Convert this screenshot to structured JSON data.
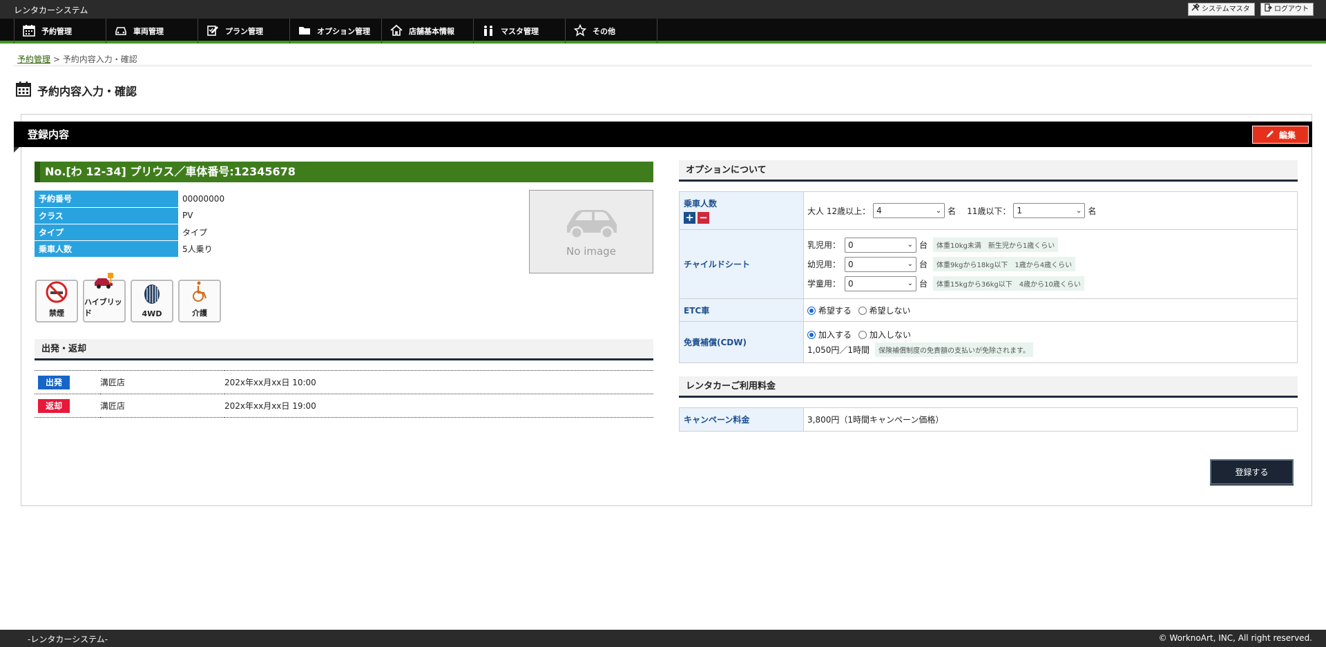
{
  "app": {
    "title": "レンタカーシステム"
  },
  "top_buttons": {
    "system_master": "システムマスタ",
    "logout": "ログアウト"
  },
  "nav": [
    {
      "label": "予約管理",
      "icon": "calendar-icon"
    },
    {
      "label": "車両管理",
      "icon": "car-icon"
    },
    {
      "label": "プラン管理",
      "icon": "edit-document-icon"
    },
    {
      "label": "オプション管理",
      "icon": "folder-icon"
    },
    {
      "label": "店舗基本情報",
      "icon": "home-icon"
    },
    {
      "label": "マスタ管理",
      "icon": "people-icon"
    },
    {
      "label": "その他",
      "icon": "star-icon"
    }
  ],
  "breadcrumb": {
    "parent": "予約管理",
    "separator": " > ",
    "current": "予約内容入力・確認"
  },
  "page_title": "予約内容入力・確認",
  "panel": {
    "title": "登録内容",
    "edit_label": "編集"
  },
  "car": {
    "title": "No.[わ 12-34] プリウス／車体番号:12345678",
    "info": [
      {
        "label": "予約番号",
        "value": "00000000"
      },
      {
        "label": "クラス",
        "value": "PV"
      },
      {
        "label": "タイプ",
        "value": "タイプ"
      },
      {
        "label": "乗車人数",
        "value": "5人乗り"
      }
    ],
    "no_image_text": "No image",
    "features": [
      {
        "label": "禁煙",
        "icon": "no-smoking-icon"
      },
      {
        "label": "ハイブリッド",
        "icon": "hybrid-car-icon"
      },
      {
        "label": "4WD",
        "icon": "tire-icon"
      },
      {
        "label": "介護",
        "icon": "wheelchair-icon"
      }
    ]
  },
  "departure": {
    "heading": "出発・返却",
    "rows": [
      {
        "badge": "出発",
        "store": "溝匠店",
        "datetime": "202x年xx月xx日 10:00",
        "color": "#1665c9"
      },
      {
        "badge": "返却",
        "store": "溝匠店",
        "datetime": "202x年xx月xx日 19:00",
        "color": "#e8183a"
      }
    ]
  },
  "options": {
    "heading": "オプションについて",
    "passengers": {
      "label": "乗車人数",
      "adult_label": "大人 12歳以上：",
      "adult_value": "4",
      "child_label": "11歳以下：",
      "child_value": "1",
      "unit": "名"
    },
    "child_seat": {
      "label": "チャイルドシート",
      "unit": "台",
      "rows": [
        {
          "label": "乳児用：",
          "value": "0",
          "note": "体重10kg未満　新生児から1歳くらい"
        },
        {
          "label": "幼児用：",
          "value": "0",
          "note": "体重9kgから18kg以下　1歳から4歳くらい"
        },
        {
          "label": "学童用：",
          "value": "0",
          "note": "体重15kgから36kg以下　4歳から10歳くらい"
        }
      ]
    },
    "etc": {
      "label": "ETC車",
      "opt_yes": "希望する",
      "opt_no": "希望しない",
      "selected": "希望する"
    },
    "cdw": {
      "label": "免責補償(CDW)",
      "opt_yes": "加入する",
      "opt_no": "加入しない",
      "selected": "加入する",
      "price": "1,050円／1時間",
      "note": "保険補償制度の免責額の支払いが免除されます。"
    }
  },
  "fee": {
    "heading": "レンタカーご利用料金",
    "label": "キャンペーン料金",
    "value": "3,800円（1時間キャンペーン価格）"
  },
  "register_label": "登録する",
  "footer": {
    "left": "-レンタカーシステム-",
    "right": "© WorknoArt, INC, All right reserved."
  },
  "colors": {
    "nav_accent": "#3d9a1e",
    "car_title_bg": "#3f7d1c",
    "info_label_bg": "#29a3e0",
    "edit_btn": "#e5311b"
  }
}
